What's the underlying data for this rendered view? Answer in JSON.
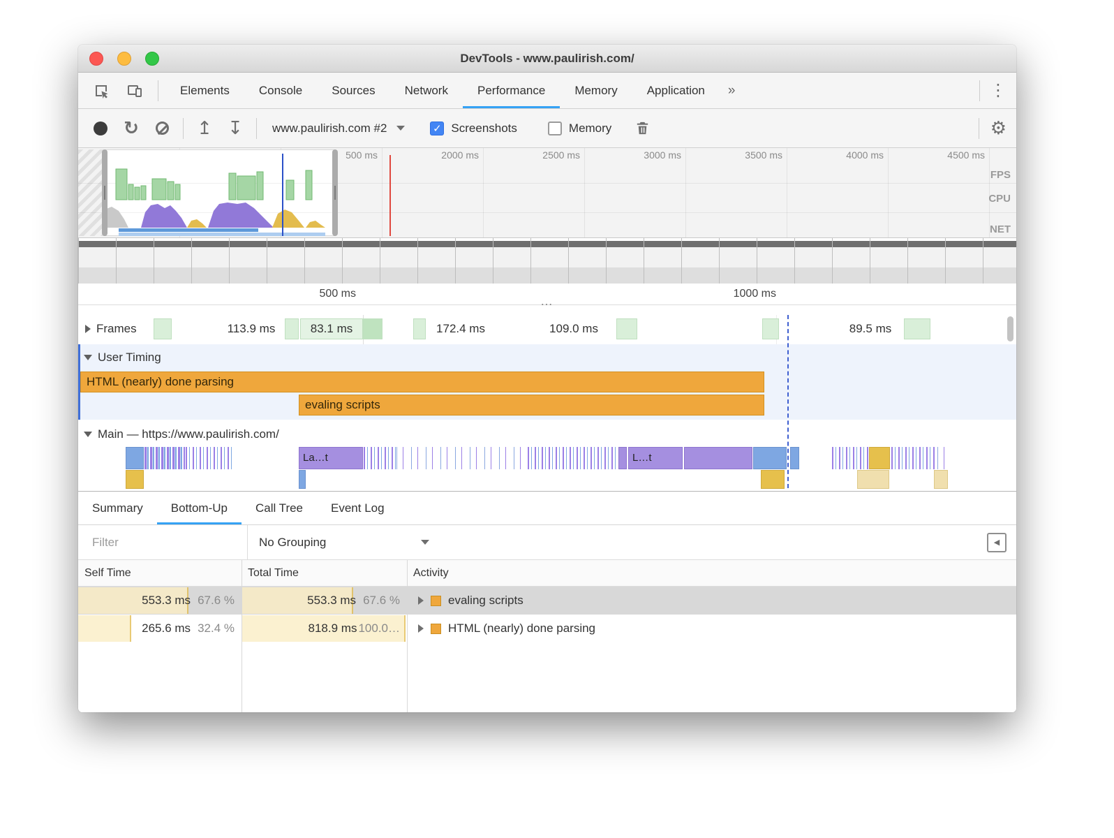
{
  "window": {
    "title": "DevTools - www.paulirish.com/"
  },
  "colors": {
    "accent_blue": "#35a2f4",
    "checkbox_blue": "#4285f4",
    "timing_orange": "#efa73c",
    "bar_yellow": "#fbeec5",
    "frame_green": "#d9efd9",
    "flame_purple": "#a58fe0",
    "flame_blue": "#7ea7e2",
    "flame_yellow": "#e6c04c"
  },
  "icons": {
    "check": "✓",
    "reload": "↻",
    "load": "↥",
    "save": "↧",
    "gear": "⚙",
    "kebab": "⋮",
    "sidebar_toggle": "◀",
    "handle_dots": "…"
  },
  "tabbar": {
    "tabs": [
      {
        "label": "Elements"
      },
      {
        "label": "Console"
      },
      {
        "label": "Sources"
      },
      {
        "label": "Network"
      },
      {
        "label": "Performance"
      },
      {
        "label": "Memory"
      },
      {
        "label": "Application"
      }
    ],
    "overflow": "»"
  },
  "toolbar": {
    "history_select": "www.paulirish.com #2",
    "screenshots_label": "Screenshots",
    "memory_label": "Memory"
  },
  "overview": {
    "time_labels": [
      "500 ms",
      "1000 ms",
      "500 ms",
      "2000 ms",
      "2500 ms",
      "3000 ms",
      "3500 ms",
      "4000 ms",
      "4500 ms"
    ],
    "lane_labels": [
      "FPS",
      "CPU",
      "NET"
    ]
  },
  "ruler": {
    "labels": [
      "500 ms",
      "1000 ms"
    ]
  },
  "tracks": {
    "frames": {
      "label": "Frames",
      "durations": [
        "113.9 ms",
        "83.1 ms",
        "172.4 ms",
        "109.0 ms",
        "89.5 ms"
      ]
    },
    "user_timing": {
      "label": "User Timing",
      "bars": [
        {
          "label": "HTML (nearly) done parsing"
        },
        {
          "label": "evaling scripts"
        }
      ]
    },
    "main": {
      "label": "Main — https://www.paulirish.com/",
      "flame_labels": [
        "La…t",
        "L…t"
      ]
    }
  },
  "bottom": {
    "tabs": [
      {
        "label": "Summary"
      },
      {
        "label": "Bottom-Up"
      },
      {
        "label": "Call Tree"
      },
      {
        "label": "Event Log"
      }
    ],
    "filter_placeholder": "Filter",
    "grouping": "No Grouping",
    "table": {
      "headers": [
        "Self Time",
        "Total Time",
        "Activity"
      ],
      "rows": [
        {
          "self_time": "553.3 ms",
          "self_pct": "67.6 %",
          "total_time": "553.3 ms",
          "total_pct": "67.6 %",
          "activity": "evaling scripts"
        },
        {
          "self_time": "265.6 ms",
          "self_pct": "32.4 %",
          "total_time": "818.9 ms",
          "total_pct": "100.0…",
          "activity": "HTML (nearly) done parsing"
        }
      ]
    }
  }
}
